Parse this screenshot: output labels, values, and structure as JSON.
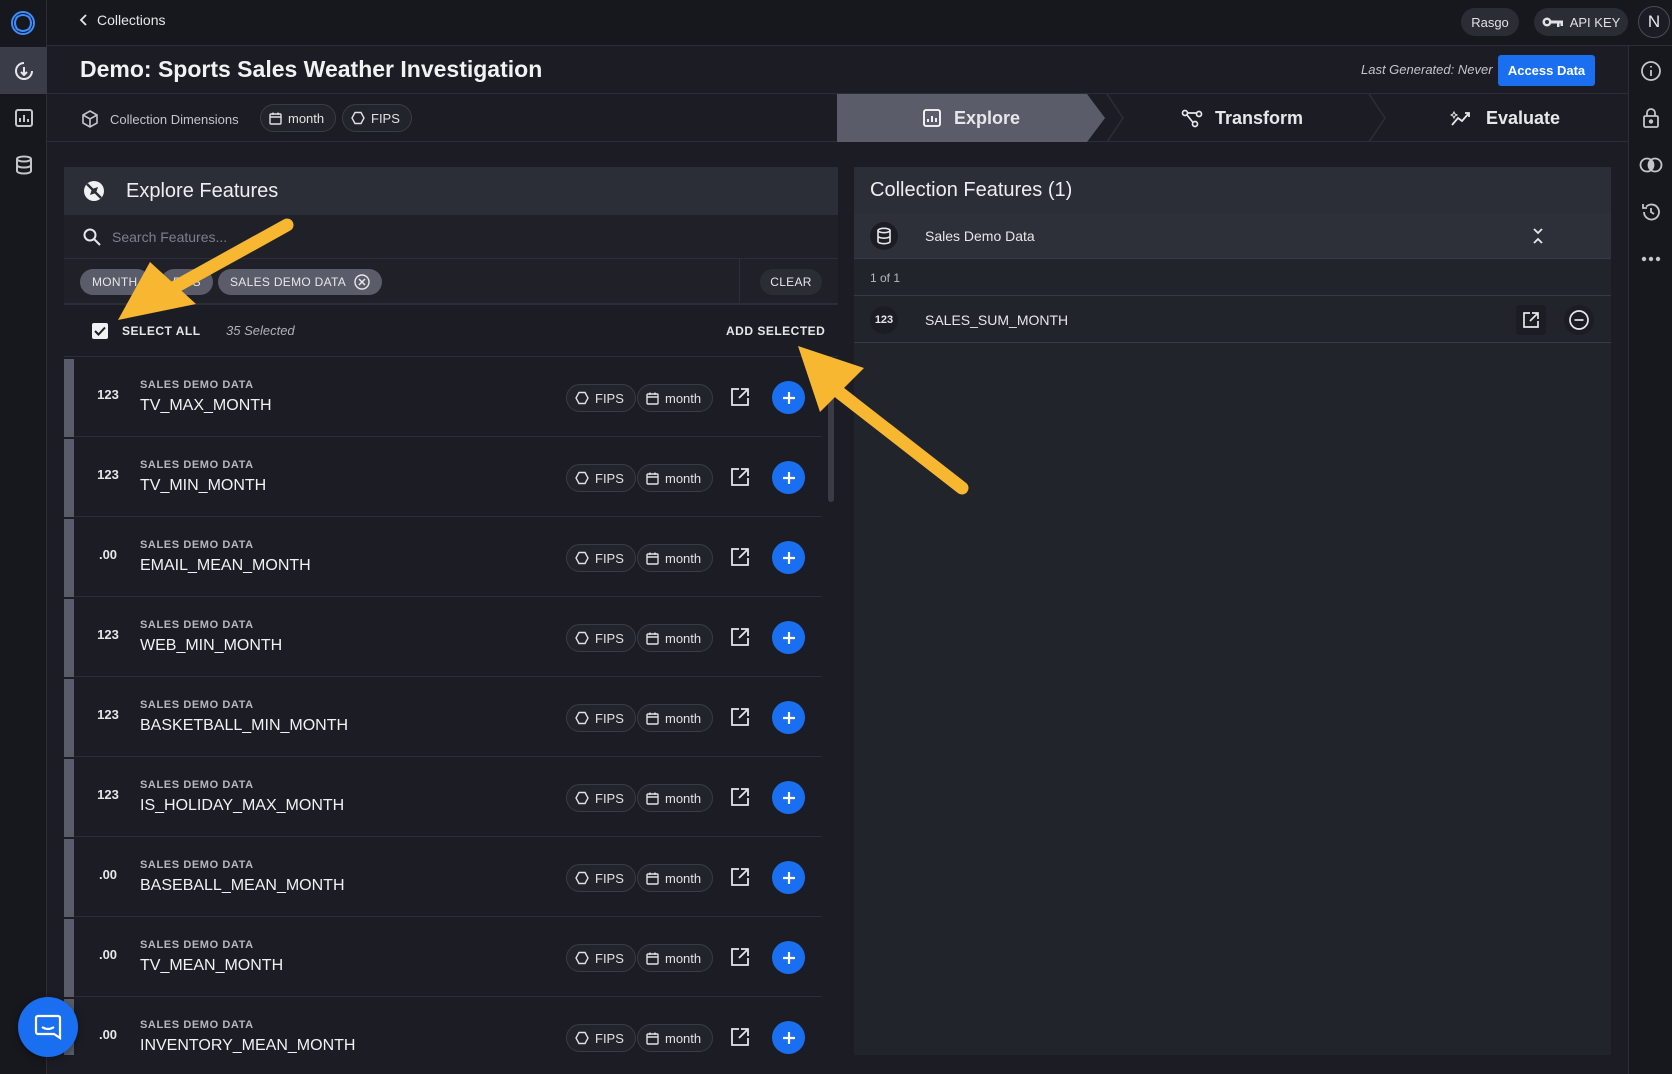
{
  "topbar": {
    "back_label": "Collections",
    "org_label": "Rasgo",
    "api_key_label": "API KEY",
    "avatar_initial": "N"
  },
  "header": {
    "title": "Demo: Sports Sales Weather Investigation",
    "last_generated": "Last Generated: Never",
    "access_button": "Access Data"
  },
  "dimensions": {
    "label": "Collection Dimensions",
    "chips": [
      "month",
      "FIPS"
    ]
  },
  "tabs": [
    {
      "label": "Explore",
      "active": true
    },
    {
      "label": "Transform",
      "active": false
    },
    {
      "label": "Evaluate",
      "active": false
    }
  ],
  "explore": {
    "title": "Explore Features",
    "search_placeholder": "Search Features...",
    "filters": [
      "MONTH",
      "FIPS",
      "SALES DEMO DATA"
    ],
    "clear_label": "CLEAR",
    "select_all_label": "SELECT ALL",
    "selected_count": "35 Selected",
    "add_selected_label": "ADD SELECTED",
    "features": [
      {
        "type": "123",
        "source": "SALES DEMO DATA",
        "name": "TV_MAX_MONTH",
        "dim1": "FIPS",
        "dim2": "month"
      },
      {
        "type": "123",
        "source": "SALES DEMO DATA",
        "name": "TV_MIN_MONTH",
        "dim1": "FIPS",
        "dim2": "month"
      },
      {
        "type": ".00",
        "source": "SALES DEMO DATA",
        "name": "EMAIL_MEAN_MONTH",
        "dim1": "FIPS",
        "dim2": "month"
      },
      {
        "type": "123",
        "source": "SALES DEMO DATA",
        "name": "WEB_MIN_MONTH",
        "dim1": "FIPS",
        "dim2": "month"
      },
      {
        "type": "123",
        "source": "SALES DEMO DATA",
        "name": "BASKETBALL_MIN_MONTH",
        "dim1": "FIPS",
        "dim2": "month"
      },
      {
        "type": "123",
        "source": "SALES DEMO DATA",
        "name": "IS_HOLIDAY_MAX_MONTH",
        "dim1": "FIPS",
        "dim2": "month"
      },
      {
        "type": ".00",
        "source": "SALES DEMO DATA",
        "name": "BASEBALL_MEAN_MONTH",
        "dim1": "FIPS",
        "dim2": "month"
      },
      {
        "type": ".00",
        "source": "SALES DEMO DATA",
        "name": "TV_MEAN_MONTH",
        "dim1": "FIPS",
        "dim2": "month"
      },
      {
        "type": ".00",
        "source": "SALES DEMO DATA",
        "name": "INVENTORY_MEAN_MONTH",
        "dim1": "FIPS",
        "dim2": "month"
      }
    ]
  },
  "collection": {
    "title": "Collection Features (1)",
    "source_label": "Sales Demo Data",
    "pagination": "1 of 1",
    "features": [
      {
        "type": "123",
        "name": "SALES_SUM_MONTH"
      }
    ]
  },
  "colors": {
    "accent": "#1a6ef0",
    "annotation_arrow": "#f7b731",
    "background": "#1c1d24"
  }
}
